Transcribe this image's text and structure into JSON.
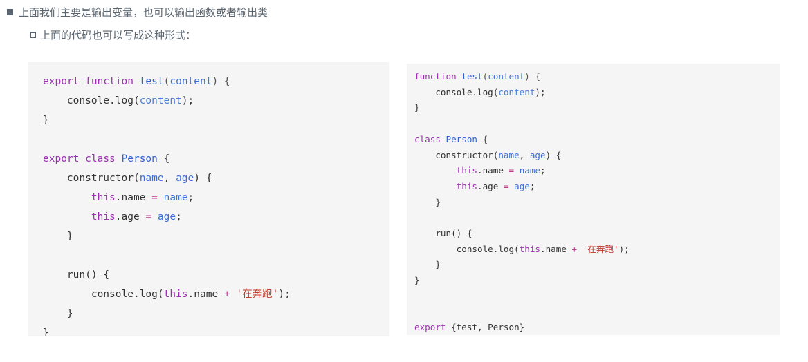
{
  "header": {
    "bullets": [
      {
        "marker": "filled-square-bullet",
        "text": "上面我们主要是输出变量，也可以输出函数或者输出类"
      },
      {
        "marker": "hollow-square-bullet",
        "text": "上面的代码也可以写成这种形式："
      }
    ]
  },
  "code_left": {
    "name": "module-export-inline-code",
    "language": "javascript",
    "lines": [
      [
        {
          "t": "export",
          "c": "tok-kw"
        },
        {
          "t": " ",
          "c": "tok-plain"
        },
        {
          "t": "function",
          "c": "tok-kw"
        },
        {
          "t": " ",
          "c": "tok-plain"
        },
        {
          "t": "test",
          "c": "tok-fn"
        },
        {
          "t": "(",
          "c": "tok-punct"
        },
        {
          "t": "content",
          "c": "tok-param"
        },
        {
          "t": ") {",
          "c": "tok-punct"
        }
      ],
      [
        {
          "t": "    console.log(",
          "c": "tok-plain"
        },
        {
          "t": "content",
          "c": "tok-arg"
        },
        {
          "t": ");",
          "c": "tok-plain"
        }
      ],
      [
        {
          "t": "}",
          "c": "tok-plain"
        }
      ],
      [],
      [
        {
          "t": "export",
          "c": "tok-kw"
        },
        {
          "t": " ",
          "c": "tok-plain"
        },
        {
          "t": "class",
          "c": "tok-kw"
        },
        {
          "t": " ",
          "c": "tok-plain"
        },
        {
          "t": "Person",
          "c": "tok-cls"
        },
        {
          "t": " {",
          "c": "tok-punct"
        }
      ],
      [
        {
          "t": "    constructor(",
          "c": "tok-plain"
        },
        {
          "t": "name",
          "c": "tok-param"
        },
        {
          "t": ", ",
          "c": "tok-plain"
        },
        {
          "t": "age",
          "c": "tok-param"
        },
        {
          "t": ") {",
          "c": "tok-plain"
        }
      ],
      [
        {
          "t": "        ",
          "c": "tok-plain"
        },
        {
          "t": "this",
          "c": "tok-this"
        },
        {
          "t": ".name ",
          "c": "tok-plain"
        },
        {
          "t": "=",
          "c": "tok-op"
        },
        {
          "t": " ",
          "c": "tok-plain"
        },
        {
          "t": "name",
          "c": "tok-param"
        },
        {
          "t": ";",
          "c": "tok-plain"
        }
      ],
      [
        {
          "t": "        ",
          "c": "tok-plain"
        },
        {
          "t": "this",
          "c": "tok-this"
        },
        {
          "t": ".age ",
          "c": "tok-plain"
        },
        {
          "t": "=",
          "c": "tok-op"
        },
        {
          "t": " ",
          "c": "tok-plain"
        },
        {
          "t": "age",
          "c": "tok-param"
        },
        {
          "t": ";",
          "c": "tok-plain"
        }
      ],
      [
        {
          "t": "    }",
          "c": "tok-plain"
        }
      ],
      [],
      [
        {
          "t": "    run() {",
          "c": "tok-plain"
        }
      ],
      [
        {
          "t": "        console.log(",
          "c": "tok-plain"
        },
        {
          "t": "this",
          "c": "tok-this"
        },
        {
          "t": ".name ",
          "c": "tok-plain"
        },
        {
          "t": "+",
          "c": "tok-op"
        },
        {
          "t": " ",
          "c": "tok-plain"
        },
        {
          "t": "'在奔跑'",
          "c": "tok-str"
        },
        {
          "t": ");",
          "c": "tok-plain"
        }
      ],
      [
        {
          "t": "    }",
          "c": "tok-plain"
        }
      ],
      [
        {
          "t": "}",
          "c": "tok-plain"
        }
      ]
    ]
  },
  "code_right": {
    "name": "module-export-statement-code",
    "language": "javascript",
    "lines": [
      [
        {
          "t": "function",
          "c": "tok-kw"
        },
        {
          "t": " ",
          "c": "tok-plain"
        },
        {
          "t": "test",
          "c": "tok-fn"
        },
        {
          "t": "(",
          "c": "tok-punct"
        },
        {
          "t": "content",
          "c": "tok-param"
        },
        {
          "t": ") {",
          "c": "tok-punct"
        }
      ],
      [
        {
          "t": "    console.log(",
          "c": "tok-plain"
        },
        {
          "t": "content",
          "c": "tok-arg"
        },
        {
          "t": ");",
          "c": "tok-plain"
        }
      ],
      [
        {
          "t": "}",
          "c": "tok-plain"
        }
      ],
      [],
      [
        {
          "t": "class",
          "c": "tok-kw"
        },
        {
          "t": " ",
          "c": "tok-plain"
        },
        {
          "t": "Person",
          "c": "tok-cls"
        },
        {
          "t": " {",
          "c": "tok-punct"
        }
      ],
      [
        {
          "t": "    constructor(",
          "c": "tok-plain"
        },
        {
          "t": "name",
          "c": "tok-param"
        },
        {
          "t": ", ",
          "c": "tok-plain"
        },
        {
          "t": "age",
          "c": "tok-param"
        },
        {
          "t": ") {",
          "c": "tok-plain"
        }
      ],
      [
        {
          "t": "        ",
          "c": "tok-plain"
        },
        {
          "t": "this",
          "c": "tok-this"
        },
        {
          "t": ".name ",
          "c": "tok-plain"
        },
        {
          "t": "=",
          "c": "tok-op"
        },
        {
          "t": " ",
          "c": "tok-plain"
        },
        {
          "t": "name",
          "c": "tok-param"
        },
        {
          "t": ";",
          "c": "tok-plain"
        }
      ],
      [
        {
          "t": "        ",
          "c": "tok-plain"
        },
        {
          "t": "this",
          "c": "tok-this"
        },
        {
          "t": ".age ",
          "c": "tok-plain"
        },
        {
          "t": "=",
          "c": "tok-op"
        },
        {
          "t": " ",
          "c": "tok-plain"
        },
        {
          "t": "age",
          "c": "tok-param"
        },
        {
          "t": ";",
          "c": "tok-plain"
        }
      ],
      [
        {
          "t": "    }",
          "c": "tok-plain"
        }
      ],
      [],
      [
        {
          "t": "    run() {",
          "c": "tok-plain"
        }
      ],
      [
        {
          "t": "        console.log(",
          "c": "tok-plain"
        },
        {
          "t": "this",
          "c": "tok-this"
        },
        {
          "t": ".name ",
          "c": "tok-plain"
        },
        {
          "t": "+",
          "c": "tok-op"
        },
        {
          "t": " ",
          "c": "tok-plain"
        },
        {
          "t": "'在奔跑'",
          "c": "tok-str"
        },
        {
          "t": ");",
          "c": "tok-plain"
        }
      ],
      [
        {
          "t": "    }",
          "c": "tok-plain"
        }
      ],
      [
        {
          "t": "}",
          "c": "tok-plain"
        }
      ],
      [],
      [],
      [
        {
          "t": "export",
          "c": "tok-kw"
        },
        {
          "t": " {test, Person}",
          "c": "tok-plain"
        }
      ]
    ]
  },
  "colors": {
    "code_background": "#f5f5f5",
    "page_background": "#ffffff",
    "body_text": "#5a6570",
    "keyword": "#9b30b0",
    "identifier": "#2f5fd0",
    "operator": "#c0398a",
    "string": "#c0392b",
    "plain_code": "#333333"
  }
}
